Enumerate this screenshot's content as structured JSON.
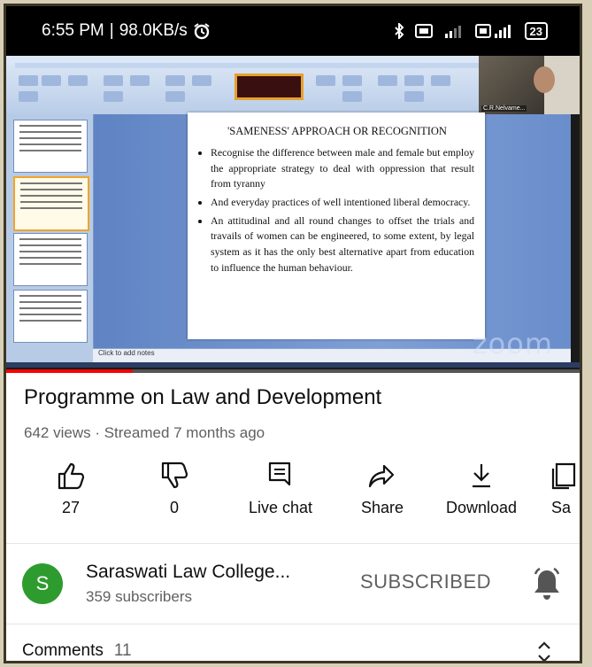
{
  "status_bar": {
    "time": "6:55 PM",
    "network_speed": "98.0KB/s",
    "battery": "23",
    "icons": [
      "alarm-icon",
      "bluetooth-icon",
      "volte-icon",
      "4g-signal-icon",
      "signal-icon",
      "battery-icon"
    ]
  },
  "video": {
    "slide": {
      "heading": "'SAMENESS' APPROACH OR RECOGNITION",
      "bullets": [
        "Recognise the difference between male and female but employ the appropriate strategy to deal with oppression that result from tyranny",
        "And everyday practices of well intentioned liberal democracy.",
        "An attitudinal and all round changes to offset the trials and travails of women can be engineered, to some extent, by legal system as it has the only best alternative apart from education to influence the human behaviour."
      ]
    },
    "participant_name": "C.R.Nelvame...",
    "watermark": "zoom",
    "notes_placeholder": "Click to add notes",
    "progress": 0.22
  },
  "video_info": {
    "title": "Programme on Law and Development",
    "meta": "642 views · Streamed 7 months ago"
  },
  "actions": [
    {
      "label": "27",
      "icon": "thumbs-up-icon"
    },
    {
      "label": "0",
      "icon": "thumbs-down-icon"
    },
    {
      "label": "Live chat",
      "icon": "live-chat-icon"
    },
    {
      "label": "Share",
      "icon": "share-icon"
    },
    {
      "label": "Download",
      "icon": "download-icon"
    },
    {
      "label": "Sa",
      "icon": "save-icon"
    }
  ],
  "channel": {
    "avatar_letter": "S",
    "name": "Saraswati Law College...",
    "subscribers": "359 subscribers",
    "subscribe_state": "SUBSCRIBED",
    "avatar_color": "#2e9b2e"
  },
  "comments": {
    "label": "Comments",
    "count": "11"
  }
}
